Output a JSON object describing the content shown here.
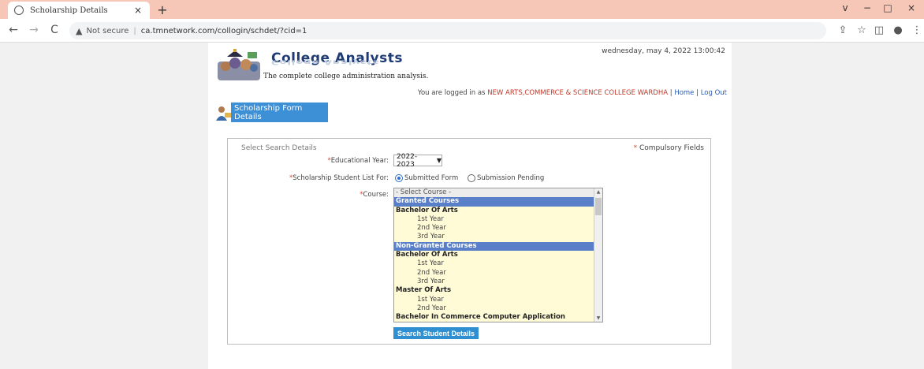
{
  "browser": {
    "tab_title": "Scholarship Details",
    "tab_close": "×",
    "new_tab": "+",
    "back": "←",
    "forward": "→",
    "reload": "C",
    "security_label": "Not secure",
    "url": "ca.tmnetwork.com/collogin/schdet/?cid=1",
    "window_min": "−",
    "window_max": "□",
    "window_close": "×",
    "window_dropdown": "v"
  },
  "header": {
    "brand": "College Analysts",
    "tagline": "The complete college administration analysis.",
    "datetime": "wednesday, may 4, 2022 13:00:42",
    "login_prefix": "You are logged in as",
    "college": "NEW ARTS,COMMERCE & SCIENCE COLLEGE WARDHA",
    "separator": "|",
    "home_link": "Home",
    "logout_link": "Log Out"
  },
  "section": {
    "title": "Scholarship Form Details"
  },
  "form": {
    "legend": "Select Search Details",
    "compulsory_star": "*",
    "compulsory_text": "Compulsory Fields",
    "year_label": "Educational Year:",
    "year_value": "2022-2023",
    "list_label": "Scholarship Student List For:",
    "radio_submitted": "Submitted Form",
    "radio_pending": "Submission Pending",
    "course_label": "Course:",
    "star": "*",
    "search_button": "Search Student Details"
  },
  "courses": [
    {
      "label": "- Select Course -",
      "kind": "placeholder"
    },
    {
      "label": "Granted Courses",
      "kind": "hdr"
    },
    {
      "label": "Bachelor Of Arts",
      "kind": "grp"
    },
    {
      "label": "1st Year",
      "kind": "sub"
    },
    {
      "label": "2nd Year",
      "kind": "sub"
    },
    {
      "label": "3rd Year",
      "kind": "sub"
    },
    {
      "label": "Non-Granted Courses",
      "kind": "hdr"
    },
    {
      "label": "Bachelor Of Arts",
      "kind": "grp"
    },
    {
      "label": "1st Year",
      "kind": "sub"
    },
    {
      "label": "2nd Year",
      "kind": "sub"
    },
    {
      "label": "3rd Year",
      "kind": "sub"
    },
    {
      "label": "Master Of Arts",
      "kind": "grp"
    },
    {
      "label": "1st Year",
      "kind": "sub"
    },
    {
      "label": "2nd Year",
      "kind": "sub"
    },
    {
      "label": "Bachelor In Commerce Computer Application",
      "kind": "grp"
    }
  ],
  "colors": {
    "tabbar": "#f6c7b6",
    "section_head": "#3d8fd6",
    "option_header": "#5a7fc9",
    "option_bg": "#fffbd6",
    "search_button": "#2f8fd0",
    "college_text": "#c0392b"
  }
}
